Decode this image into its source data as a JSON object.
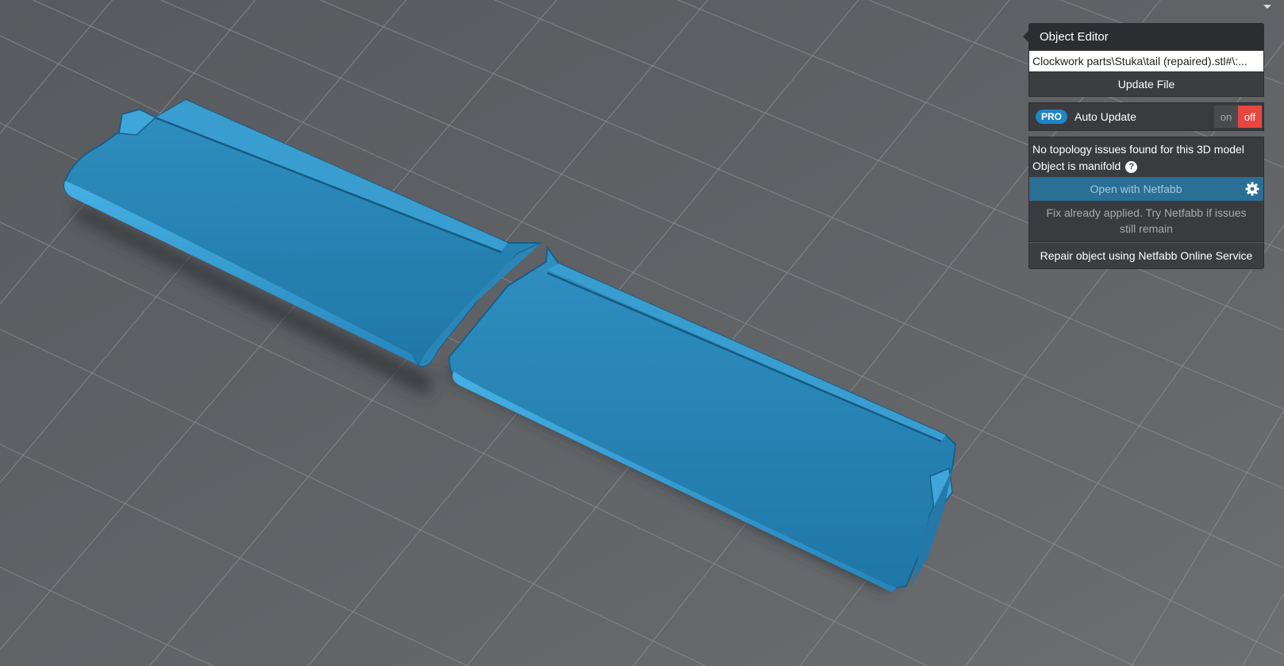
{
  "panel": {
    "title": "Object Editor",
    "file_path": "...:\\#Clockwork parts\\Stuka\\tail (repaired).stl",
    "update_label": "Update File",
    "auto_update": {
      "badge": "PRO",
      "label": "Auto Update",
      "on_label": "on",
      "off_label": "off",
      "state": "off"
    },
    "topology": {
      "message": "No topology issues found for this 3D model",
      "manifold": "Object is manifold",
      "help_icon": "?"
    },
    "netfabb_label": "Open with Netfabb",
    "fix_note": "Fix already applied. Try Netfabb if issues still remain",
    "repair_label": "Repair object using Netfabb Online Service"
  },
  "colors": {
    "model": "#2e8fc2",
    "floor": "#5f6164",
    "panel_bg": "#3a3b3f",
    "panel_header": "#2c2d30",
    "accent": "#1f86c4",
    "toggle_off": "#e8473f"
  },
  "icons": [
    "help-icon",
    "gear-icon",
    "dropdown-arrow-icon"
  ]
}
